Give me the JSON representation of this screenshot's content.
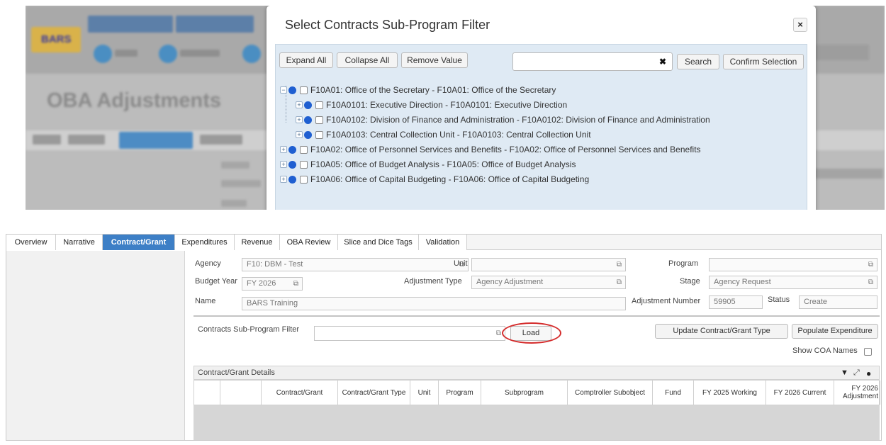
{
  "modal": {
    "title": "Select Contracts Sub-Program Filter",
    "close_icon": "×",
    "buttons": {
      "expand_all": "Expand All",
      "collapse_all": "Collapse All",
      "remove_value": "Remove Value",
      "search": "Search",
      "confirm": "Confirm Selection"
    },
    "search": {
      "value": "",
      "clear_icon": "✖"
    },
    "tree": [
      {
        "label": "F10A01: Office of the Secretary - F10A01: Office of the Secretary",
        "toggle": "−"
      },
      {
        "label": "F10A0101: Executive Direction - F10A0101: Executive Direction",
        "toggle": "+"
      },
      {
        "label": "F10A0102: Division of Finance and Administration - F10A0102: Division of Finance and Administration",
        "toggle": "+"
      },
      {
        "label": "F10A0103: Central Collection Unit - F10A0103: Central Collection Unit",
        "toggle": "+"
      },
      {
        "label": "F10A02: Office of Personnel Services and Benefits - F10A02: Office of Personnel Services and Benefits",
        "toggle": "+"
      },
      {
        "label": "F10A05: Office of Budget Analysis - F10A05: Office of Budget Analysis",
        "toggle": "+"
      },
      {
        "label": "F10A06: Office of Capital Budgeting - F10A06: Office of Capital Budgeting",
        "toggle": "+"
      }
    ]
  },
  "tabs": [
    "Overview",
    "Narrative",
    "Contract/Grant",
    "Expenditures",
    "Revenue",
    "OBA Review",
    "Slice and Dice Tags",
    "Validation"
  ],
  "form": {
    "agency_label": "Agency",
    "agency_value": "F10: DBM - Test",
    "unit_label": "Unit",
    "unit_value": "",
    "program_label": "Program",
    "program_value": "",
    "budget_year_label": "Budget Year",
    "budget_year_value": "FY 2026",
    "adjustment_type_label": "Adjustment Type",
    "adjustment_type_value": "Agency Adjustment",
    "stage_label": "Stage",
    "stage_value": "Agency Request",
    "name_label": "Name",
    "name_value": "BARS Training",
    "adjustment_number_label": "Adjustment Number",
    "adjustment_number_value": "59905",
    "status_label": "Status",
    "status_value": "Create",
    "lookup_icon": "⧉"
  },
  "filter": {
    "label": "Contracts Sub-Program Filter",
    "value": "",
    "load_button": "Load",
    "update_button": "Update Contract/Grant Type",
    "populate_button": "Populate Expenditure",
    "show_coa_label": "Show COA Names"
  },
  "grid": {
    "title": "Contract/Grant Details",
    "icons": {
      "filter_icon": "▼",
      "expand_icon": "⤢",
      "settings_icon": "●"
    },
    "columns": [
      "",
      "",
      "Contract/Grant",
      "Contract/Grant Type",
      "Unit",
      "Program",
      "Subprogram",
      "Comptroller Subobject",
      "Fund",
      "FY 2025 Working",
      "FY 2026 Current",
      "FY 2026 Adjustment"
    ]
  }
}
